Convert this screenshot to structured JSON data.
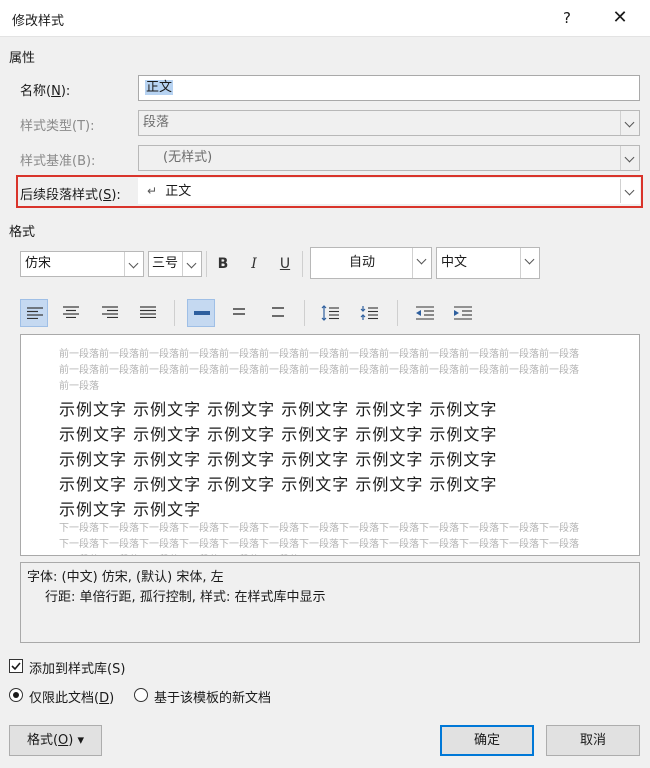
{
  "window": {
    "title": "修改样式",
    "help_label": "?",
    "close_label": "✕"
  },
  "properties": {
    "section_label": "属性",
    "name_label": "名称(",
    "name_key": "N",
    "name_label_end": "):",
    "name_value": "正文",
    "type_label": "样式类型(T):",
    "type_value": "段落",
    "based_label": "样式基准(B):",
    "based_value": "(无样式)",
    "next_label": "后续段落样式(",
    "next_key": "S",
    "next_label_end": "):",
    "next_symbol": "↵",
    "next_value": "正文"
  },
  "format": {
    "section_label": "格式",
    "font_value": "仿宋",
    "size_value": "三号",
    "bold_label": "B",
    "italic_label": "I",
    "underline_label": "U",
    "color_value": "自动",
    "script_value": "中文"
  },
  "preview": {
    "prev_para": "前一段落前一段落前一段落前一段落前一段落前一段落前一段落前一段落前一段落前一段落前一段落前一段落前一段落前一段落前一段落前一段落前一段落前一段落前一段落前一段落前一段落前一段落前一段落前一段落前一段落前一段落前一段落",
    "sample_lines": [
      "示例文字 示例文字 示例文字 示例文字 示例文字 示例文字",
      "示例文字 示例文字 示例文字 示例文字 示例文字 示例文字",
      "示例文字 示例文字 示例文字 示例文字 示例文字 示例文字",
      "示例文字 示例文字 示例文字 示例文字 示例文字 示例文字",
      "示例文字 示例文字"
    ],
    "next_para": "下一段落下一段落下一段落下一段落下一段落下一段落下一段落下一段落下一段落下一段落下一段落下一段落下一段落下一段落下一段落下一段落下一段落下一段落下一段落下一段落下一段落下一段落下一段落下一段落下一段落下一段落下一段落下一段落下一段落下一段落下一段落下一段落"
  },
  "description": {
    "line1": "字体: (中文) 仿宋, (默认) 宋体, 左",
    "line2": "行距: 单倍行距, 孤行控制, 样式: 在样式库中显示"
  },
  "options": {
    "add_to_gallery": "添加到样式库(S)",
    "this_doc_pre": "仅限此文档(",
    "this_doc_key": "D",
    "this_doc_post": ")",
    "new_docs": "基于该模板的新文档"
  },
  "buttons": {
    "format_pre": "格式(",
    "format_key": "O",
    "format_post": ")",
    "format_arrow": "▾",
    "ok": "确定",
    "cancel": "取消"
  },
  "icons": [
    "help-icon",
    "close-icon",
    "chevron-down-icon",
    "return-arrow-icon",
    "align-left-icon",
    "align-center-icon",
    "align-right-icon",
    "justify-icon",
    "line-spacing-single-icon",
    "line-spacing-onehalf-icon",
    "line-spacing-double-icon",
    "paragraph-spacing-increase-icon",
    "paragraph-spacing-decrease-icon",
    "indent-decrease-icon",
    "indent-increase-icon",
    "checkbox-checked-icon"
  ],
  "colors": {
    "accent": "#0078d7",
    "highlight_frame": "#d9342b",
    "selection": "#b7d3f2",
    "active_align": "#c5d9f1"
  }
}
